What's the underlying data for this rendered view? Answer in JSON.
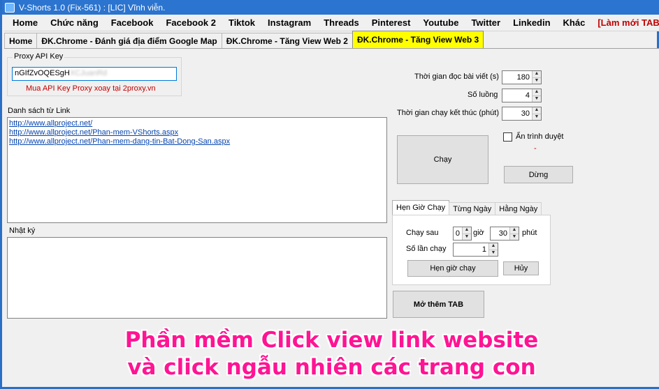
{
  "window": {
    "title": "V-Shorts 1.0 (Fix-561) : [LIC] Vĩnh viễn."
  },
  "menu": [
    {
      "label": "Home"
    },
    {
      "label": "Chức năng"
    },
    {
      "label": "Facebook"
    },
    {
      "label": "Facebook 2"
    },
    {
      "label": "Tiktok"
    },
    {
      "label": "Instagram"
    },
    {
      "label": "Threads"
    },
    {
      "label": "Pinterest"
    },
    {
      "label": "Youtube"
    },
    {
      "label": "Twitter"
    },
    {
      "label": "Linkedin"
    },
    {
      "label": "Khác"
    },
    {
      "label": "[Làm mới TAB]"
    }
  ],
  "tabs": [
    {
      "label": "Home"
    },
    {
      "label": "ĐK.Chrome - Đánh giá địa điểm Google Map"
    },
    {
      "label": "ĐK.Chrome - Tăng View Web 2"
    },
    {
      "label": "ĐK.Chrome - Tăng View Web 3"
    }
  ],
  "proxy": {
    "group_title": "Proxy API Key",
    "key_value": "nGIfZvOQESgH",
    "key_hidden": "XCJuanRd",
    "hint": "Mua API Key Proxy xoay tại 2proxy.vn"
  },
  "links": {
    "label": "Danh sách từ Link",
    "items": [
      "http://www.allproject.net/",
      "http://www.allproject.net/Phan-mem-VShorts.aspx",
      "http://www.allproject.net/Phan-mem-dang-tin-Bat-Dong-San.aspx"
    ]
  },
  "log": {
    "label": "Nhật ký"
  },
  "settings": {
    "read_time_label": "Thời gian đọc bài viết (s)",
    "read_time_value": "180",
    "threads_label": "Số luồng",
    "threads_value": "4",
    "end_time_label": "Thời gian chạy kết thúc (phút)",
    "end_time_value": "30",
    "hide_browser_label": "Ẩn trình duyệt",
    "dash": "-",
    "run_label": "Chạy",
    "stop_label": "Dừng"
  },
  "schedule": {
    "tabs": [
      {
        "label": "Hẹn Giờ Chạy"
      },
      {
        "label": "Từng Ngày"
      },
      {
        "label": "Hằng Ngày"
      }
    ],
    "run_after_label": "Chạy sau",
    "hours_value": "0",
    "hours_unit": "giờ",
    "minutes_value": "30",
    "minutes_unit": "phút",
    "runs_label": "Số lần chạy",
    "runs_value": "1",
    "schedule_button": "Hẹn giờ chạy",
    "cancel_button": "Hủy"
  },
  "open_tab_button": "Mở thêm TAB",
  "banner": {
    "line1": "Phần mềm Click view link website",
    "line2": "và click ngẫu nhiên các trang con"
  }
}
